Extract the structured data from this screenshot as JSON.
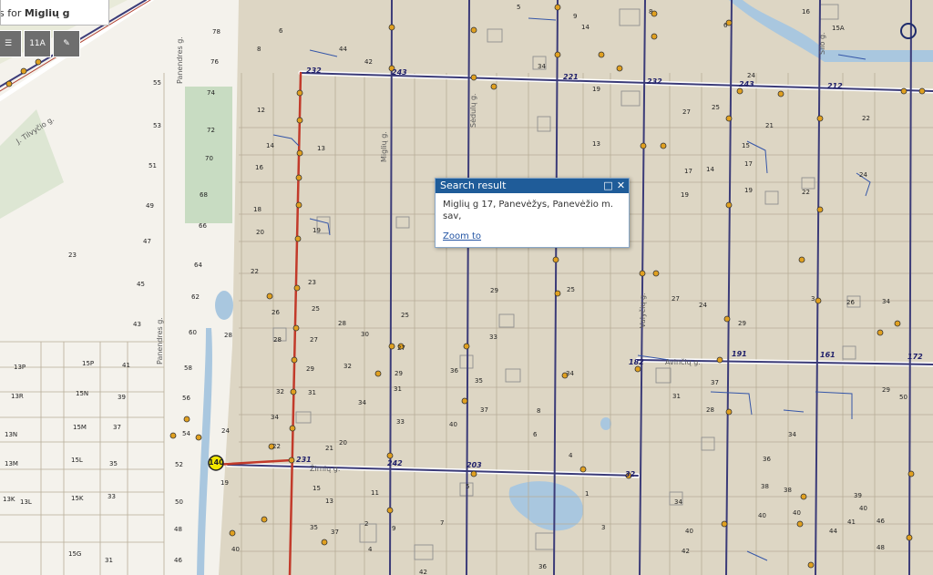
{
  "search": {
    "prefix": "s for",
    "query": "Miglių g"
  },
  "toolbar": {
    "zoom_label": "11A"
  },
  "popup": {
    "title": "Search result",
    "address_line1": "Miglių g 17, Panevėžys, Panevėžio m.",
    "address_line2": "sav,",
    "zoom_link": "Zoom to"
  },
  "roads": {
    "tilvycio": "J. Tilvyčio g.",
    "panendres1": "Panendres g.",
    "panendres2": "Panendres g.",
    "migliu": "Miglių g.",
    "sedulu": "Sėdulų g.",
    "valyciu": "Valyčių g.",
    "avinciu": "Avinčių g.",
    "silo": "Silo g.",
    "zirniu": "Žirnių g."
  },
  "routes": [
    "232",
    "243",
    "221",
    "232",
    "243",
    "212",
    "191",
    "161",
    "172",
    "182",
    "231",
    "242",
    "203",
    "32",
    "140"
  ],
  "lots": [
    "78",
    "76",
    "74",
    "72",
    "70",
    "68",
    "66",
    "64",
    "62",
    "60",
    "58",
    "56",
    "54",
    "52",
    "50",
    "48",
    "46",
    "55",
    "53",
    "51",
    "49",
    "47",
    "45",
    "43",
    "41",
    "39",
    "37",
    "35",
    "33",
    "31",
    "13P",
    "13R",
    "13M",
    "13K",
    "15P",
    "15N",
    "15M",
    "15L",
    "15K",
    "15G",
    "23",
    "12",
    "14",
    "16",
    "18",
    "20",
    "22",
    "24",
    "26",
    "28",
    "30",
    "32",
    "34",
    "36",
    "38",
    "40",
    "42",
    "44",
    "13",
    "15",
    "17",
    "19",
    "21",
    "25",
    "27",
    "29",
    "15A",
    "16"
  ]
}
